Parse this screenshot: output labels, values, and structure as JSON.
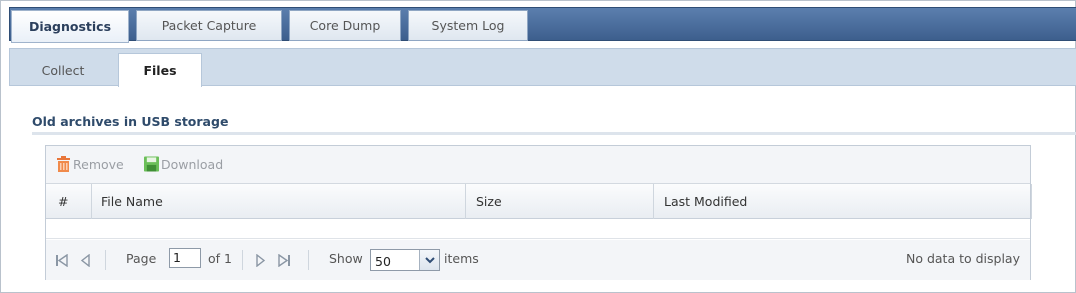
{
  "tabs": [
    {
      "label": "Diagnostics",
      "active": true
    },
    {
      "label": "Packet Capture",
      "active": false
    },
    {
      "label": "Core Dump",
      "active": false
    },
    {
      "label": "System Log",
      "active": false
    }
  ],
  "subtabs": [
    {
      "label": "Collect",
      "active": false
    },
    {
      "label": "Files",
      "active": true
    }
  ],
  "section": {
    "title": "Old archives in USB storage"
  },
  "toolbar": {
    "remove_label": "Remove",
    "download_label": "Download"
  },
  "table": {
    "columns": [
      "#",
      "File Name",
      "Size",
      "Last Modified"
    ],
    "rows": []
  },
  "pager": {
    "page_label": "Page",
    "page_value": "1",
    "of_label": "of 1",
    "show_label": "Show",
    "show_value": "50",
    "items_label": "items",
    "status": "No data to display"
  },
  "icons": {
    "remove": "trash-icon",
    "download": "floppy-disk-icon",
    "first": "first-page-icon",
    "prev": "previous-page-icon",
    "next": "next-page-icon",
    "last": "last-page-icon",
    "dropdown": "chevron-down-icon"
  },
  "colors": {
    "accent": "#3d5f8d",
    "subbar": "#cfdcea",
    "section_title": "#2f4b6b"
  }
}
